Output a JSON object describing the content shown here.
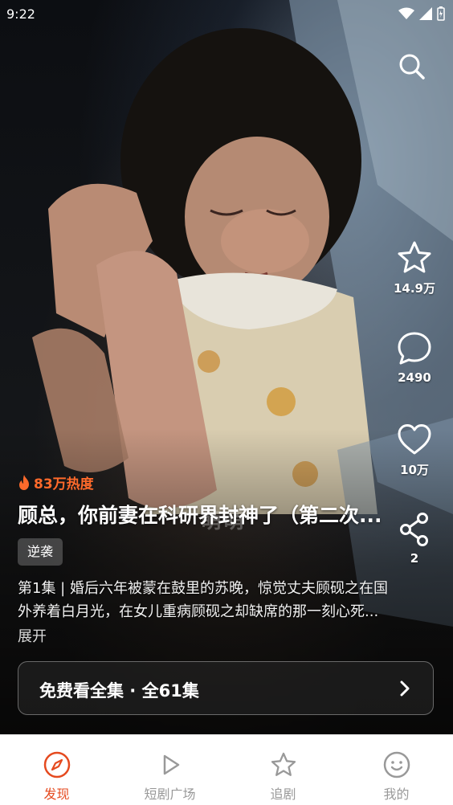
{
  "status_bar": {
    "time": "9:22"
  },
  "actions": {
    "collect_count": "14.9万",
    "comment_count": "2490",
    "like_count": "10万",
    "share_count": "2"
  },
  "drama": {
    "heat": "83万热度",
    "title": "顾总，你前妻在科研界封神了（第二次...",
    "watermark": "萌萌",
    "tag": "逆袭",
    "description_line1": "第1集 | 婚后六年被蒙在鼓里的苏晚，惊觉丈夫顾砚之在国",
    "description_line2": "外养着白月光，在女儿重病顾砚之却缺席的那一刻心死...",
    "expand_label": "展开",
    "watch_all_label": "免费看全集 · 全61集"
  },
  "tabs": [
    {
      "label": "发现",
      "icon": "compass-icon",
      "active": true
    },
    {
      "label": "短剧广场",
      "icon": "play-icon",
      "active": false
    },
    {
      "label": "追剧",
      "icon": "star-icon",
      "active": false
    },
    {
      "label": "我的",
      "icon": "smile-icon",
      "active": false
    }
  ],
  "colors": {
    "accent": "#e54a1f",
    "heat": "#ff6a2b",
    "tab_inactive": "#999999"
  }
}
